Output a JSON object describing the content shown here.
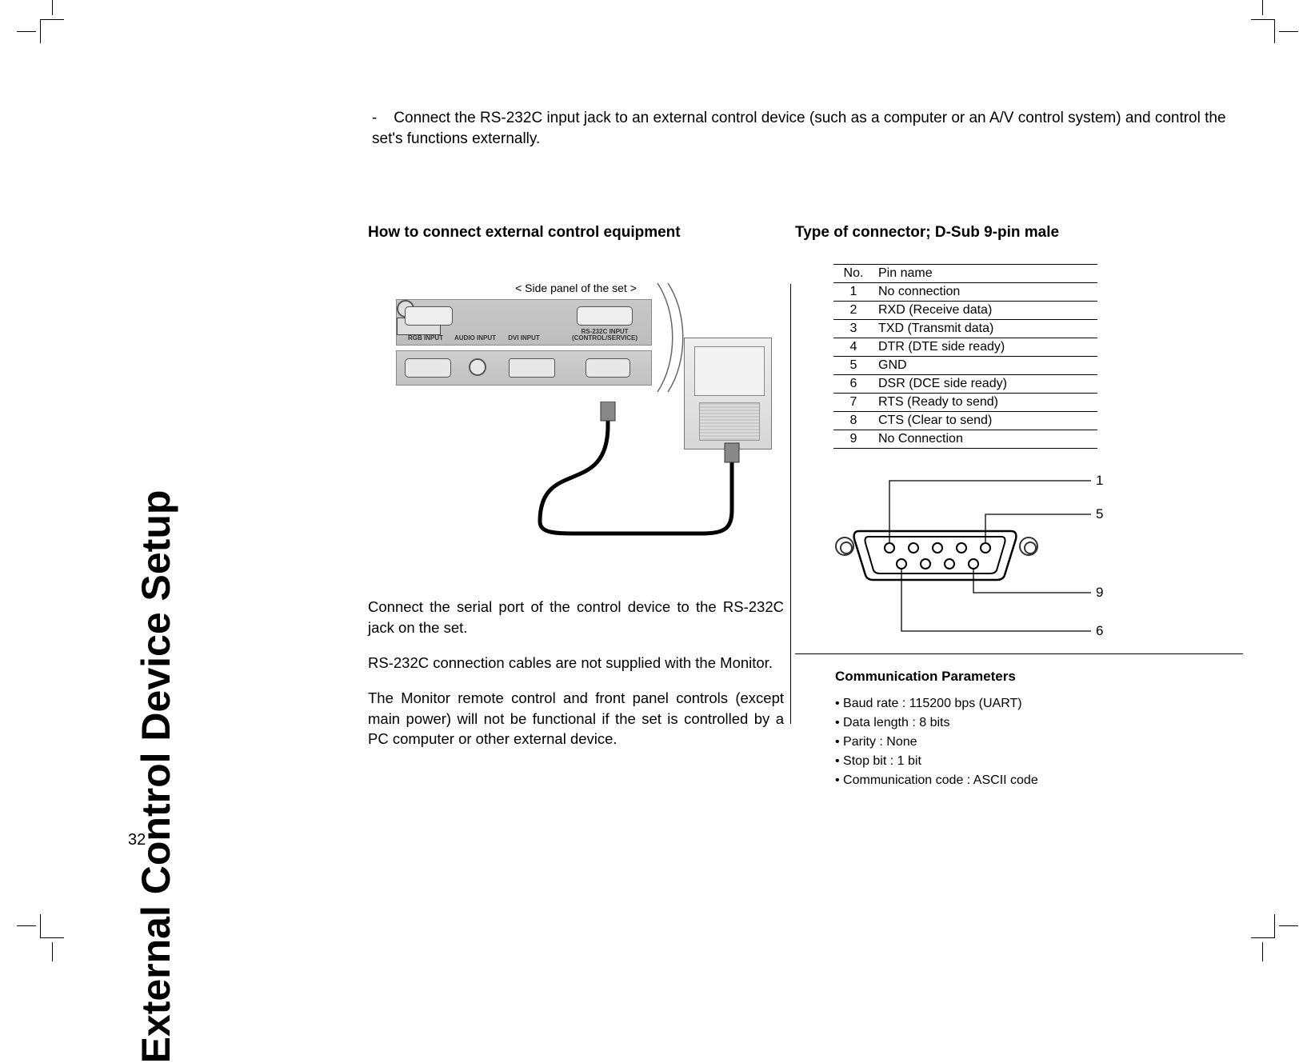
{
  "page_number": "32",
  "side_title": "External Control Device Setup",
  "intro_text": "Connect the RS-232C input jack to an external control device (such as a computer or an A/V control system) and control the set's functions externally.",
  "left": {
    "heading": "How to connect external control equipment",
    "side_panel_label": "< Side panel of the set >",
    "port_labels": {
      "rgb": "RGB INPUT",
      "audio": "AUDIO INPUT",
      "dvi": "DVI INPUT",
      "rs232": "RS-232C INPUT (CONTROL/SERVICE)"
    },
    "para1": "Connect the serial port of the control device to the RS-232C jack on the set.",
    "para2": "RS-232C connection cables are not supplied with the Monitor.",
    "para3": "The Monitor remote control and front panel controls (except main power) will not be functional if the set is controlled by a PC computer or other external device."
  },
  "right": {
    "heading": "Type of connector; D-Sub 9-pin male",
    "table": {
      "header_no": "No.",
      "header_name": "Pin name",
      "rows": [
        {
          "no": "1",
          "name": "No connection"
        },
        {
          "no": "2",
          "name": "RXD (Receive data)"
        },
        {
          "no": "3",
          "name": "TXD (Transmit data)"
        },
        {
          "no": "4",
          "name": "DTR (DTE side ready)"
        },
        {
          "no": "5",
          "name": "GND"
        },
        {
          "no": "6",
          "name": "DSR (DCE side ready)"
        },
        {
          "no": "7",
          "name": "RTS (Ready to send)"
        },
        {
          "no": "8",
          "name": "CTS (Clear to send)"
        },
        {
          "no": "9",
          "name": "No Connection"
        }
      ]
    },
    "pin_callouts": {
      "p1": "1",
      "p5": "5",
      "p6": "6",
      "p9": "9"
    },
    "comm_heading": "Communication Parameters",
    "comm": {
      "baud": "Baud rate : 115200 bps (UART)",
      "data": "Data length : 8 bits",
      "parity": "Parity : None",
      "stop": "Stop bit : 1 bit",
      "code": "Communication code : ASCII code"
    }
  }
}
